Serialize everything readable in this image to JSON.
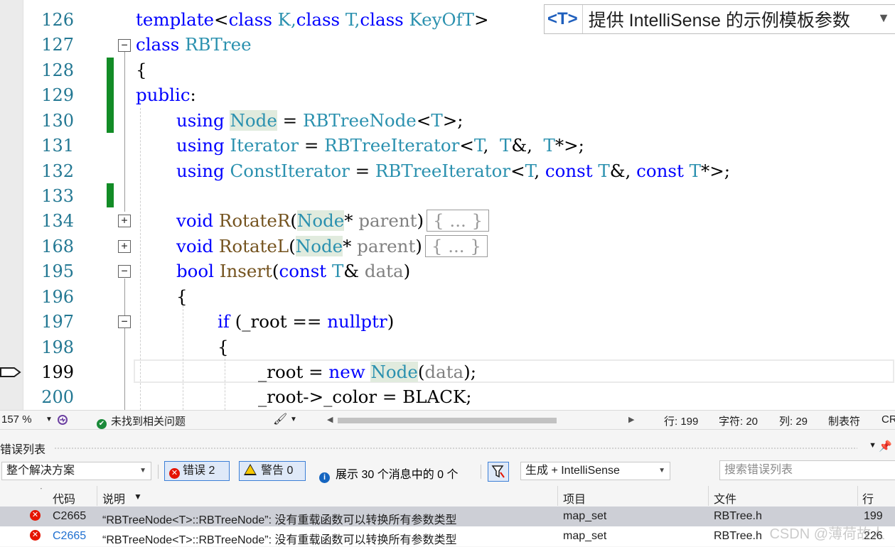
{
  "intellisense": {
    "tag": "<T>",
    "text": "提供 IntelliSense 的示例模板参数",
    "arrow": "▼"
  },
  "editor": {
    "lines": [
      {
        "num": "126"
      },
      {
        "num": "127"
      },
      {
        "num": "128"
      },
      {
        "num": "129"
      },
      {
        "num": "130"
      },
      {
        "num": "131"
      },
      {
        "num": "132"
      },
      {
        "num": "133"
      },
      {
        "num": "134"
      },
      {
        "num": "168"
      },
      {
        "num": "195"
      },
      {
        "num": "196"
      },
      {
        "num": "197"
      },
      {
        "num": "198"
      },
      {
        "num": "199"
      },
      {
        "num": "200"
      }
    ],
    "tokens": {
      "l126": [
        "template",
        "<",
        "class",
        " K,",
        "class",
        " T,",
        "class",
        " KeyOfT",
        ">"
      ],
      "l127": [
        "class",
        " RBTree"
      ],
      "l128": [
        "{"
      ],
      "l129": [
        "public",
        ":"
      ],
      "l130": [
        "using",
        "Node",
        " = ",
        "RBTreeNode",
        "<",
        "T",
        ">;"
      ],
      "l131": [
        "using",
        "Iterator",
        " = ",
        "RBTreeIterator",
        "<",
        "T",
        ",  ",
        "T",
        "&,  ",
        "T",
        "*>;"
      ],
      "l132": [
        "using",
        "ConstIterator",
        " = ",
        "RBTreeIterator",
        "<",
        "T",
        ", ",
        "const",
        " ",
        "T",
        "&, ",
        "const",
        " ",
        "T",
        "*>;"
      ],
      "l134": [
        "void",
        " RotateR",
        "(",
        "Node",
        "*",
        " parent",
        ")",
        "{ ... }"
      ],
      "l168": [
        "void",
        " RotateL",
        "(",
        "Node",
        "*",
        " parent",
        ")",
        "{ ... }"
      ],
      "l195": [
        "bool",
        " Insert",
        "(",
        "const",
        " ",
        "T",
        "&",
        " data",
        ")"
      ],
      "l196": [
        "{"
      ],
      "l197": [
        "if",
        " (_root == ",
        "nullptr",
        ")"
      ],
      "l198": [
        "{"
      ],
      "l199": [
        "_root = ",
        "new",
        " ",
        "Node",
        "(",
        "data",
        ")",
        ";"
      ],
      "l200": [
        "_root->_color = BLACK;"
      ]
    },
    "fold_plus": "+",
    "fold_minus": "−"
  },
  "status_bar": {
    "zoom": "157 %",
    "issues": "未找到相关问题",
    "line": "行: 199",
    "char": "字符: 20",
    "col": "列: 29",
    "tabs": "制表符",
    "eol": "CR"
  },
  "error_list": {
    "title": "错误列表",
    "scope": "整个解决方案",
    "errors_btn": "错误 2",
    "warnings_btn": "警告 0",
    "messages": "展示 30 个消息中的 0 个",
    "build_filter": "生成 + IntelliSense",
    "search_placeholder": "搜索错误列表",
    "columns": {
      "code": "代码",
      "desc": "说明",
      "project": "项目",
      "file": "文件",
      "line": "行"
    },
    "rows": [
      {
        "code": "C2665",
        "desc": "“RBTreeNode<T>::RBTreeNode”: 没有重载函数可以转换所有参数类型",
        "project": "map_set",
        "file": "RBTree.h",
        "line": "199"
      },
      {
        "code": "C2665",
        "desc": "“RBTreeNode<T>::RBTreeNode”: 没有重载函数可以转换所有参数类型",
        "project": "map_set",
        "file": "RBTree.h",
        "line": "226"
      }
    ]
  },
  "watermark": "CSDN @薄荷故人",
  "colors": {
    "keyword": "#0000ff",
    "type": "#2b91af",
    "change_bar": "#128c26",
    "error": "#e51400"
  }
}
